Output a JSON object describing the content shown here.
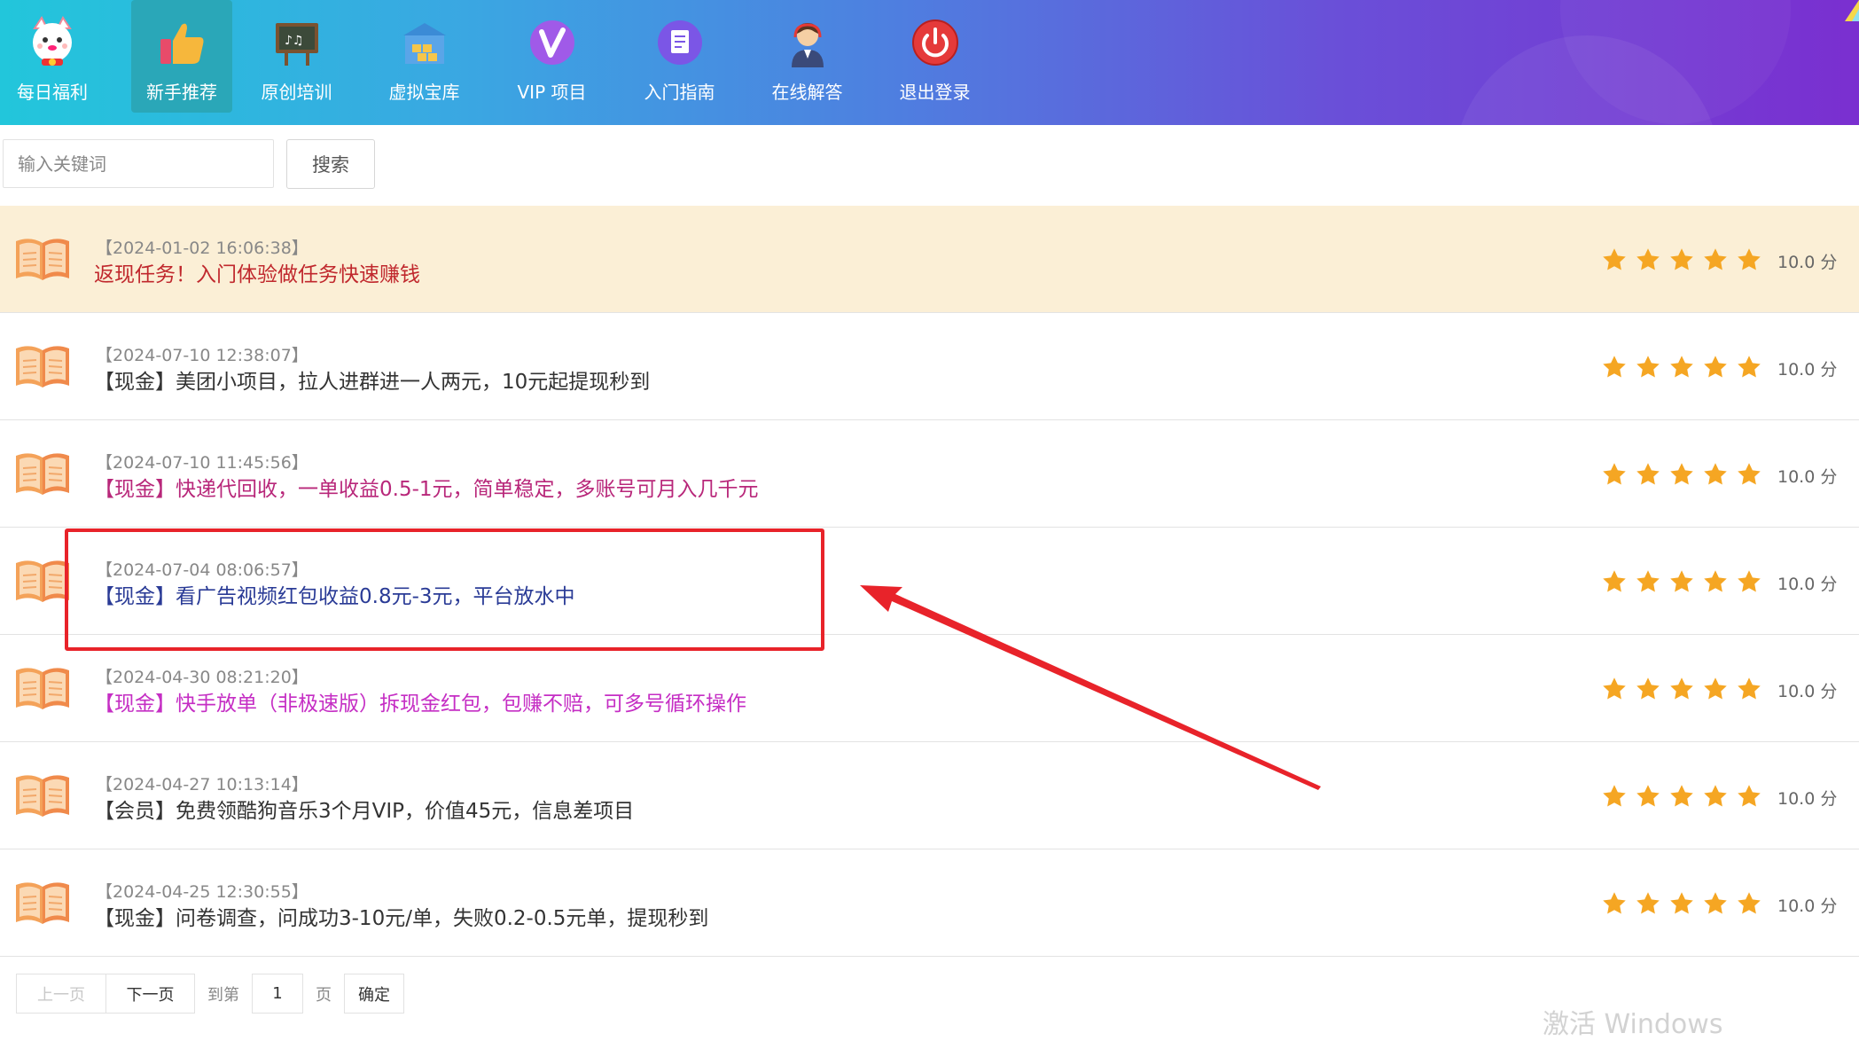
{
  "nav": {
    "items": [
      {
        "label": "每日福利",
        "icon": "lucky-cat-icon"
      },
      {
        "label": "新手推荐",
        "icon": "thumbs-up-icon",
        "active": true
      },
      {
        "label": "原创培训",
        "icon": "blackboard-icon"
      },
      {
        "label": "虚拟宝库",
        "icon": "warehouse-icon"
      },
      {
        "label": "VIP 项目",
        "icon": "vip-icon"
      },
      {
        "label": "入门指南",
        "icon": "document-icon"
      },
      {
        "label": "在线解答",
        "icon": "support-agent-icon"
      },
      {
        "label": "退出登录",
        "icon": "power-icon"
      }
    ]
  },
  "search": {
    "placeholder": "输入关键词",
    "button_label": "搜索"
  },
  "list": {
    "items": [
      {
        "date": "【2024-01-02 16:06:38】",
        "title": "返现任务！入门体验做任务快速赚钱",
        "title_color": "#c0282d",
        "highlighted": true,
        "score": "10.0 分",
        "stars": 5
      },
      {
        "date": "【2024-07-10 12:38:07】",
        "title": "【现金】美团小项目，拉人进群进一人两元，10元起提现秒到",
        "title_color": "#333333",
        "score": "10.0 分",
        "stars": 5
      },
      {
        "date": "【2024-07-10 11:45:56】",
        "title": "【现金】快递代回收，一单收益0.5-1元，简单稳定，多账号可月入几千元",
        "title_color": "#b8277a",
        "score": "10.0 分",
        "stars": 5
      },
      {
        "date": "【2024-07-04 08:06:57】",
        "title": "【现金】看广告视频红包收益0.8元-3元，平台放水中",
        "title_color": "#2a3b96",
        "score": "10.0 分",
        "stars": 5
      },
      {
        "date": "【2024-04-30 08:21:20】",
        "title": "【现金】快手放单（非极速版）拆现金红包，包赚不赔，可多号循环操作",
        "title_color": "#c52ec4",
        "score": "10.0 分",
        "stars": 5
      },
      {
        "date": "【2024-04-27 10:13:14】",
        "title": "【会员】免费领酷狗音乐3个月VIP，价值45元，信息差项目",
        "title_color": "#333333",
        "score": "10.0 分",
        "stars": 5
      },
      {
        "date": "【2024-04-25 12:30:55】",
        "title": "【现金】问卷调查，问成功3-10元/单，失败0.2-0.5元单，提现秒到",
        "title_color": "#333333",
        "score": "10.0 分",
        "stars": 5
      }
    ]
  },
  "pager": {
    "prev_label": "上一页",
    "next_label": "下一页",
    "goto_label": "到第",
    "page_value": "1",
    "page_unit": "页",
    "confirm_label": "确定"
  },
  "watermark": "激活 Windows",
  "colors": {
    "star": "#f5a623",
    "highlight_row": "#fbefd6",
    "annotation_red": "#e8232a"
  }
}
